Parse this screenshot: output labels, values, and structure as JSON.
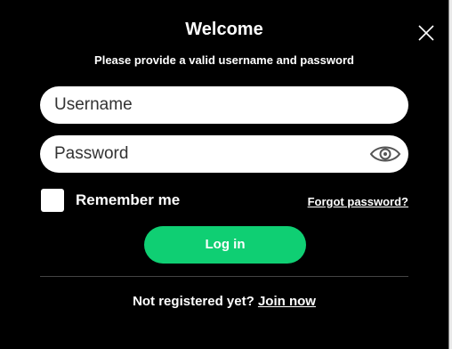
{
  "dialog": {
    "title": "Welcome",
    "subtitle": "Please provide a valid username and password",
    "close_icon": "close-icon"
  },
  "form": {
    "username": {
      "placeholder": "Username",
      "value": ""
    },
    "password": {
      "placeholder": "Password",
      "value": "",
      "toggle_icon": "eye-icon"
    },
    "remember_me": {
      "label": "Remember me",
      "checked": false
    },
    "forgot_password": "Forgot password?",
    "login_button": "Log in"
  },
  "footer": {
    "prompt": "Not registered yet?",
    "join_link": "Join now"
  },
  "colors": {
    "background": "#000000",
    "accent": "#0fcf73",
    "text": "#ffffff"
  }
}
